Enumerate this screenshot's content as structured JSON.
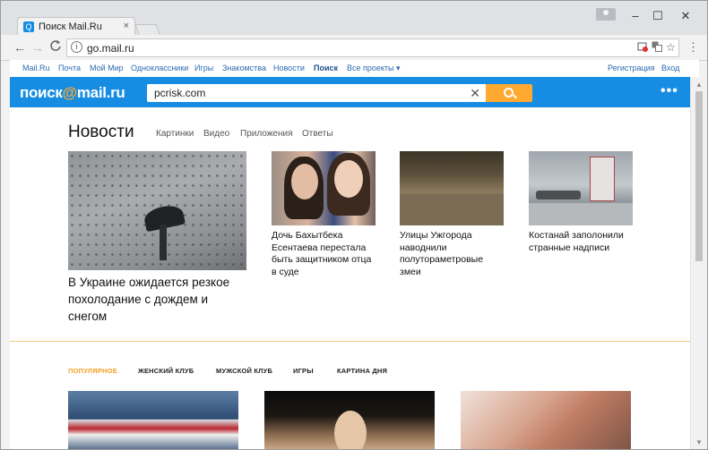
{
  "browser": {
    "tab_title": "Поиск Mail.Ru",
    "tab_favicon": "Q",
    "tab_close": "×",
    "url": "go.mail.ru",
    "window_buttons": {
      "minimize": "–",
      "maximize": "☐",
      "close": "✕"
    },
    "nav": {
      "back": "←",
      "forward": "→",
      "reload": "C"
    }
  },
  "topnav": {
    "items": [
      "Mail.Ru",
      "Почта",
      "Мой Мир",
      "Одноклассники",
      "Игры",
      "Знакомства",
      "Новости",
      "Поиск",
      "Все проекты ▾"
    ],
    "register": "Регистрация",
    "login": "Вход"
  },
  "search": {
    "logo_left": "поиск",
    "logo_at": "@",
    "logo_right": "mail.ru",
    "query": "pcrisk.com",
    "clear": "✕",
    "more": "•••"
  },
  "news": {
    "heading": "Новости",
    "tabs": [
      "Картинки",
      "Видео",
      "Приложения",
      "Ответы"
    ],
    "main_headline": "В Украине ожидается резкое похолодание с дождем и снегом",
    "items": [
      {
        "headline": "Дочь Бахытбека Есентаева перестала быть защитником отца в суде"
      },
      {
        "headline": "Улицы Ужгорода наводнили полутораметровые змеи"
      },
      {
        "headline": "Костанай заполонили странные надписи"
      }
    ]
  },
  "categories": {
    "items": [
      "ПОПУЛЯРНОЕ",
      "ЖЕНСКИЙ КЛУБ",
      "МУЖСКОЙ КЛУБ",
      "ИГРЫ",
      "КАРТИНА ДНЯ"
    ],
    "active": "ПОПУЛЯРНОЕ"
  },
  "colors": {
    "brand_blue": "#168de2",
    "accent_orange": "#ffa930",
    "link_blue": "#2b6bb0"
  }
}
